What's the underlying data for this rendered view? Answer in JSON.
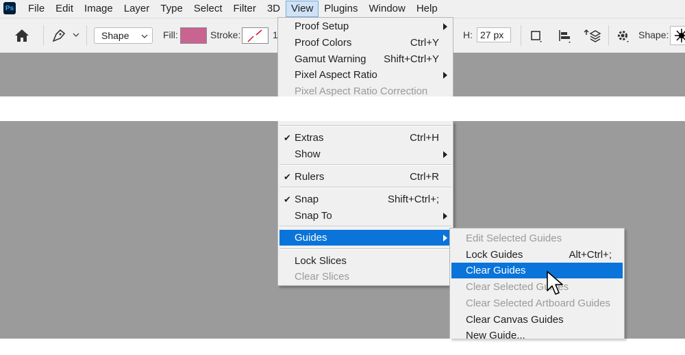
{
  "app": {
    "logo_text": "Ps"
  },
  "menubar": {
    "items": [
      {
        "label": "File"
      },
      {
        "label": "Edit"
      },
      {
        "label": "Image"
      },
      {
        "label": "Layer"
      },
      {
        "label": "Type"
      },
      {
        "label": "Select"
      },
      {
        "label": "Filter"
      },
      {
        "label": "3D"
      },
      {
        "label": "View",
        "active": true
      },
      {
        "label": "Plugins"
      },
      {
        "label": "Window"
      },
      {
        "label": "Help"
      }
    ]
  },
  "options_bar": {
    "home_icon": "home-icon",
    "tool_icon": "pen-shape-tool-icon",
    "mode_value": "Shape",
    "fill_label": "Fill:",
    "fill_color": "#c8648f",
    "stroke_label": "Stroke:",
    "stroke_width_partial": "1",
    "h_label": "H:",
    "h_value": "27 px",
    "shape_label": "Shape:"
  },
  "view_menu": {
    "top_items": [
      {
        "label": "Proof Setup",
        "shortcut": "",
        "submenu": true,
        "disabled": false
      },
      {
        "label": "Proof Colors",
        "shortcut": "Ctrl+Y",
        "submenu": false,
        "disabled": false
      },
      {
        "label": "Gamut Warning",
        "shortcut": "Shift+Ctrl+Y",
        "submenu": false,
        "disabled": false
      },
      {
        "label": "Pixel Aspect Ratio",
        "shortcut": "",
        "submenu": true,
        "disabled": false
      },
      {
        "label": "Pixel Aspect Ratio Correction",
        "shortcut": "",
        "submenu": false,
        "disabled": true
      }
    ],
    "bottom_items": [
      {
        "label": "Extras",
        "shortcut": "Ctrl+H",
        "checked": true
      },
      {
        "label": "Show",
        "shortcut": "",
        "submenu": true
      },
      {
        "label": "Rulers",
        "shortcut": "Ctrl+R",
        "checked": true
      },
      {
        "label": "Snap",
        "shortcut": "Shift+Ctrl+;",
        "checked": true
      },
      {
        "label": "Snap To",
        "shortcut": "",
        "submenu": true
      },
      {
        "label": "Guides",
        "shortcut": "",
        "submenu": true,
        "highlighted": true
      },
      {
        "label": "Lock Slices",
        "shortcut": ""
      },
      {
        "label": "Clear Slices",
        "shortcut": "",
        "disabled": true
      }
    ]
  },
  "guides_submenu": {
    "items": [
      {
        "label": "Edit Selected Guides",
        "shortcut": "",
        "disabled": true
      },
      {
        "label": "Lock Guides",
        "shortcut": "Alt+Ctrl+;",
        "disabled": false
      },
      {
        "label": "Clear Guides",
        "shortcut": "",
        "highlighted": true
      },
      {
        "label": "Clear Selected Guides",
        "shortcut": "",
        "disabled": true
      },
      {
        "label": "Clear Selected Artboard Guides",
        "shortcut": "",
        "disabled": true
      },
      {
        "label": "Clear Canvas Guides",
        "shortcut": "",
        "disabled": false
      },
      {
        "label": "New Guide...",
        "shortcut": "",
        "disabled": false
      }
    ]
  },
  "colors": {
    "menu_bg": "#f0f0f0",
    "highlight": "#0a74da",
    "canvas": "#9b9b9b",
    "disabled_text": "#9a9a9a"
  }
}
